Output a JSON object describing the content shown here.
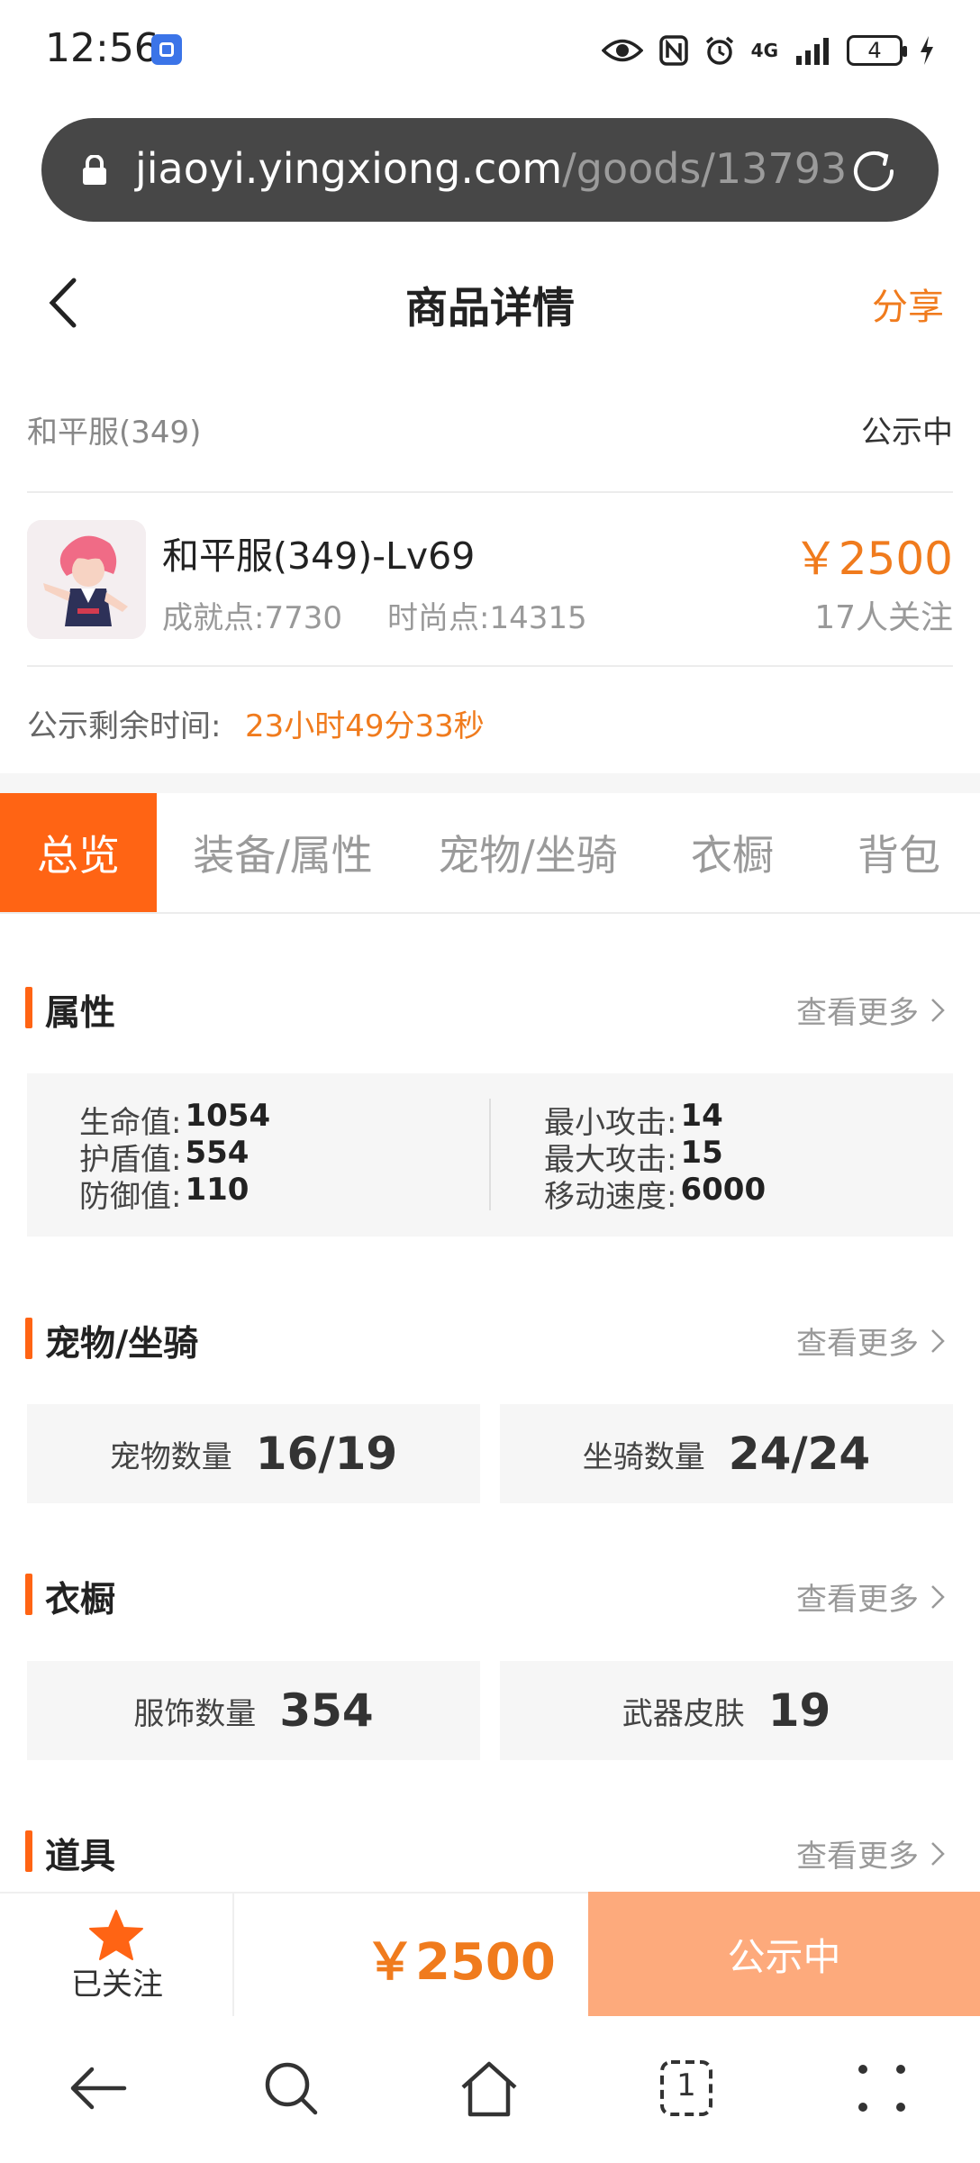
{
  "status_bar": {
    "time": "12:56",
    "network": "4G",
    "battery": "4",
    "icons": [
      "eye-icon",
      "nfc-icon",
      "alarm-icon",
      "signal-icon",
      "battery-icon",
      "charging-icon"
    ]
  },
  "browser": {
    "url_host": "jiaoyi.yingxiong.com",
    "url_path": "/goods/13793",
    "tab_count": "1"
  },
  "header": {
    "title": "商品详情",
    "share": "分享"
  },
  "product": {
    "server": "和平服(349)",
    "status": "公示中",
    "name": "和平服(349)-Lv69",
    "achievement": "成就点:7730",
    "fashion": "时尚点:14315",
    "price": "￥2500",
    "followers": "17人关注",
    "countdown_label": "公示剩余时间:",
    "countdown_value": "23小时49分33秒"
  },
  "tabs": [
    {
      "label": "总览",
      "active": true
    },
    {
      "label": "装备/属性",
      "active": false
    },
    {
      "label": "宠物/坐骑",
      "active": false
    },
    {
      "label": "衣橱",
      "active": false
    },
    {
      "label": "背包",
      "active": false
    }
  ],
  "sections": {
    "more_label": "查看更多",
    "attributes": {
      "title": "属性",
      "left": [
        {
          "label": "生命值:",
          "value": "1054"
        },
        {
          "label": "护盾值:",
          "value": "554"
        },
        {
          "label": "防御值:",
          "value": "110"
        }
      ],
      "right": [
        {
          "label": "最小攻击:",
          "value": "14"
        },
        {
          "label": "最大攻击:",
          "value": "15"
        },
        {
          "label": "移动速度:",
          "value": "6000"
        }
      ]
    },
    "pets": {
      "title": "宠物/坐骑",
      "cards": [
        {
          "label": "宠物数量",
          "value": "16/19"
        },
        {
          "label": "坐骑数量",
          "value": "24/24"
        }
      ]
    },
    "wardrobe": {
      "title": "衣橱",
      "cards": [
        {
          "label": "服饰数量",
          "value": "354"
        },
        {
          "label": "武器皮肤",
          "value": "19"
        }
      ]
    },
    "items": {
      "title": "道具"
    }
  },
  "action_bar": {
    "follow_label": "已关注",
    "price": "￥2500",
    "cta": "公示中"
  },
  "colors": {
    "accent": "#ff6414",
    "price": "#f07b1d",
    "cta_disabled": "#fdaa7c",
    "url_bar": "#474747"
  }
}
